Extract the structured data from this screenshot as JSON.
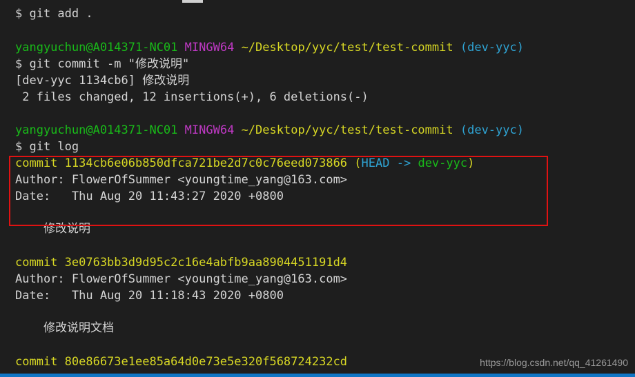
{
  "terminal": {
    "lines": {
      "l1": "$ git add .",
      "prompt1": {
        "user_host": "yangyuchun@A014371-NC01",
        "env": "MINGW64",
        "path": "~/Desktop/yyc/test/test-commit",
        "branch": "(dev-yyc)"
      },
      "l3": "$ git commit -m \"修改说明\"",
      "l4": "[dev-yyc 1134cb6] 修改说明",
      "l5": " 2 files changed, 12 insertions(+), 6 deletions(-)",
      "prompt2": {
        "user_host": "yangyuchun@A014371-NC01",
        "env": "MINGW64",
        "path": "~/Desktop/yyc/test/test-commit",
        "branch": "(dev-yyc)"
      },
      "l7": "$ git log",
      "commit1": {
        "label": "commit 1134cb6e06b850dfca721be2d7c0c76eed073866",
        "paren_open": "(",
        "head": "HEAD ->",
        "branch": "dev-yyc",
        "paren_close": ")"
      },
      "author1": "Author: FlowerOfSummer <youngtime_yang@163.com>",
      "date1": "Date:   Thu Aug 20 11:43:27 2020 +0800",
      "msg1": "    修改说明",
      "commit2": "commit 3e0763bb3d9d95c2c16e4abfb9aa8904451191d4",
      "author2": "Author: FlowerOfSummer <youngtime_yang@163.com>",
      "date2": "Date:   Thu Aug 20 11:18:43 2020 +0800",
      "msg2": "    修改说明文档",
      "commit3": "commit 80e86673e1ee85a64d0e73e5e320f568724232cd"
    }
  },
  "watermark": "https://blog.csdn.net/qq_41261490",
  "colors": {
    "background": "#1e1e1e",
    "prompt_user": "#19bb19",
    "prompt_env": "#bf39c4",
    "prompt_path": "#d7d724",
    "prompt_branch": "#2fa4d4",
    "commit_hash": "#d7d724",
    "highlight_box": "#e01212",
    "status_bar": "#0f76c6"
  }
}
